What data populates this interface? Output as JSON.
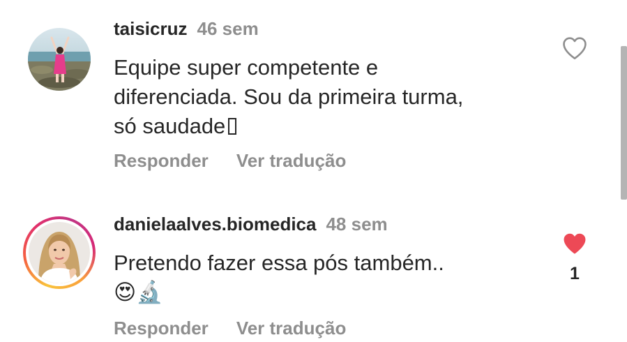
{
  "comments": [
    {
      "username": "taisicruz",
      "time": "46 sem",
      "text": "Equipe super competente e\ndiferenciada. Sou da primeira turma,\nsó saudade",
      "reply_label": "Responder",
      "translate_label": "Ver tradução",
      "liked": false,
      "like_count": ""
    },
    {
      "username": "danielaalves.biomedica",
      "time": "48 sem",
      "text": "Pretendo fazer essa pós também..",
      "emojis": "😍🔬",
      "reply_label": "Responder",
      "translate_label": "Ver tradução",
      "liked": true,
      "like_count": "1"
    }
  ],
  "colors": {
    "text": "#262626",
    "muted": "#8e8e8e",
    "like_red": "#ed4956",
    "story_ring": [
      "#f9c33b",
      "#e1306c",
      "#c13584"
    ]
  },
  "icons": {
    "like_empty": "heart-outline-icon",
    "like_filled": "heart-filled-icon"
  }
}
